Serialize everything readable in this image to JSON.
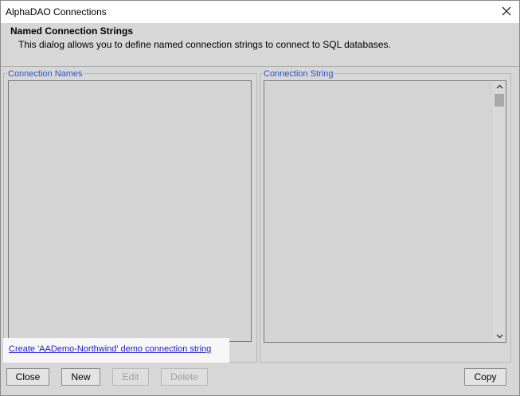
{
  "window": {
    "title": "AlphaDAO Connections"
  },
  "header": {
    "title": "Named Connection Strings",
    "description": "This dialog allows you to define named connection strings to connect to SQL databases."
  },
  "left_panel": {
    "label": "Connection Names",
    "items": []
  },
  "right_panel": {
    "label": "Connection String",
    "value": ""
  },
  "link": {
    "text": "Create 'AADemo-Northwind' demo connection string"
  },
  "buttons": {
    "close": "Close",
    "new": "New",
    "edit": "Edit",
    "delete": "Delete",
    "copy": "Copy"
  },
  "colors": {
    "panel_label": "#2b52cc",
    "link": "#1a1ad8",
    "background": "#d7d7d7"
  },
  "icons": {
    "window_close": "close-icon",
    "scroll_up": "chevron-up-icon",
    "scroll_down": "chevron-down-icon"
  }
}
